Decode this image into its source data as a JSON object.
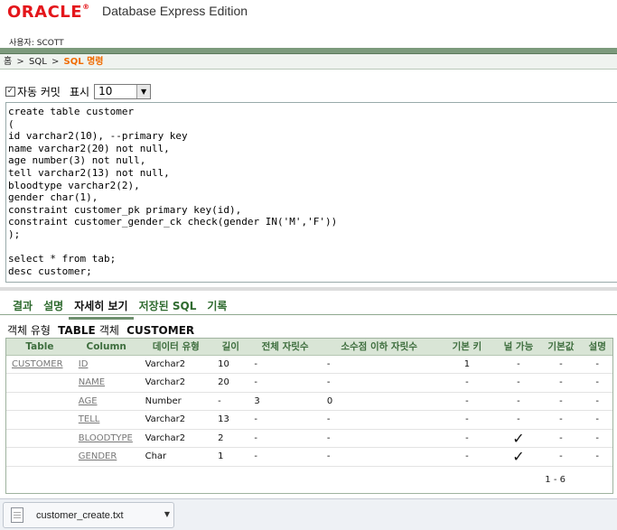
{
  "header": {
    "brand": "ORACLE",
    "product": "Database Express Edition",
    "user_line": "사용자: SCOTT"
  },
  "breadcrumb": {
    "home": "홈",
    "sql": "SQL",
    "current": "SQL 명령",
    "separator": ">"
  },
  "toolbar": {
    "autocommit_label": "자동 커밋",
    "autocommit_checked": true,
    "display_label": "표시",
    "display_value": "10"
  },
  "editor": {
    "text": "create table customer\n(\nid varchar2(10), --primary key\nname varchar2(20) not null,\nage number(3) not null,\ntell varchar2(13) not null,\nbloodtype varchar2(2),\ngender char(1),\nconstraint customer_pk primary key(id),\nconstraint customer_gender_ck check(gender IN('M','F'))\n);\n\nselect * from tab;\ndesc customer;"
  },
  "tabs": [
    {
      "label": "결과",
      "active": false
    },
    {
      "label": "설명",
      "active": false
    },
    {
      "label": "자세히 보기",
      "active": true
    },
    {
      "label": "저장된 SQL",
      "active": false
    },
    {
      "label": "기록",
      "active": false
    }
  ],
  "object": {
    "type_label": "객체 유형",
    "type_value": "TABLE",
    "object_label": "객체",
    "object_name": "CUSTOMER"
  },
  "table": {
    "headers": [
      "Table",
      "Column",
      "데이터 유형",
      "길이",
      "전체 자릿수",
      "소수점 이하 자릿수",
      "기본 키",
      "널 가능",
      "기본값",
      "설명"
    ],
    "rows": [
      {
        "table": "CUSTOMER",
        "column": "ID",
        "type": "Varchar2",
        "length": "10",
        "precision": "-",
        "scale": "-",
        "pk": "1",
        "nullable": "-",
        "default": "-",
        "comment": "-"
      },
      {
        "table": "",
        "column": "NAME",
        "type": "Varchar2",
        "length": "20",
        "precision": "-",
        "scale": "-",
        "pk": "-",
        "nullable": "-",
        "default": "-",
        "comment": "-"
      },
      {
        "table": "",
        "column": "AGE",
        "type": "Number",
        "length": "-",
        "precision": "3",
        "scale": "0",
        "pk": "-",
        "nullable": "-",
        "default": "-",
        "comment": "-"
      },
      {
        "table": "",
        "column": "TELL",
        "type": "Varchar2",
        "length": "13",
        "precision": "-",
        "scale": "-",
        "pk": "-",
        "nullable": "-",
        "default": "-",
        "comment": "-"
      },
      {
        "table": "",
        "column": "BLOODTYPE",
        "type": "Varchar2",
        "length": "2",
        "precision": "-",
        "scale": "-",
        "pk": "-",
        "nullable": "✓",
        "default": "-",
        "comment": "-"
      },
      {
        "table": "",
        "column": "GENDER",
        "type": "Char",
        "length": "1",
        "precision": "-",
        "scale": "-",
        "pk": "-",
        "nullable": "✓",
        "default": "-",
        "comment": "-"
      }
    ],
    "pager": "1 - 6"
  },
  "download": {
    "filename": "customer_create.txt",
    "icon": "text-file-icon"
  }
}
